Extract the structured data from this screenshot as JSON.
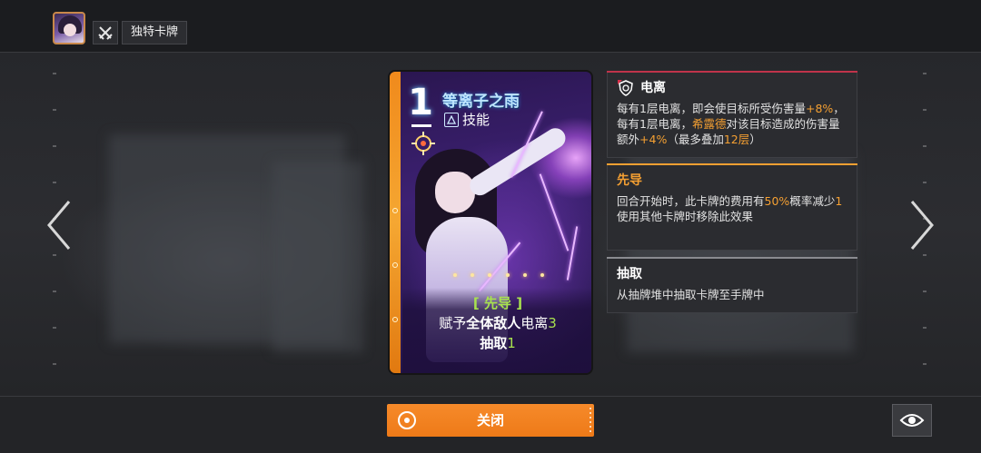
{
  "header": {
    "title": "独特卡牌",
    "avatar_icon": "character-portrait",
    "mode_icon": "crossed-swords-icon"
  },
  "card": {
    "cost": "1",
    "name": "等离子之雨",
    "type_icon": "skill-triangle-icon",
    "type": "技能",
    "keyword_tag": "[ 先导 ]",
    "desc_line1_prefix": "赋予",
    "desc_line1_highlight": "全体敌人",
    "desc_line1_text": "电离",
    "desc_line1_num": "3",
    "desc_line2_text": "抽取",
    "desc_line2_num": "1"
  },
  "panels": [
    {
      "title": "电离",
      "icon": "ionize-shield-icon",
      "accent": "#c0334a",
      "body_parts": [
        "每有1层电离，即会使目标所受伤害量",
        "+8%",
        "，每有1层电离，",
        "希露德",
        "对该目标造成的伤害量额外",
        "+4%",
        "（最多叠加",
        "12层",
        "）"
      ]
    },
    {
      "title": "先导",
      "accent": "#f5a032",
      "body_parts": [
        "回合开始时，此卡牌的费用有",
        "50%",
        "概率减少",
        "1"
      ],
      "body_line2": "使用其他卡牌时移除此效果"
    },
    {
      "title": "抽取",
      "accent": "#8a8b90",
      "body": "从抽牌堆中抽取卡牌至手牌中"
    }
  ],
  "footer": {
    "close_label": "关闭",
    "eye_icon": "eye-icon"
  },
  "colors": {
    "accent_orange": "#ee7a18",
    "keyword_green": "#a8e24e",
    "highlight_orange": "#f5a032"
  }
}
